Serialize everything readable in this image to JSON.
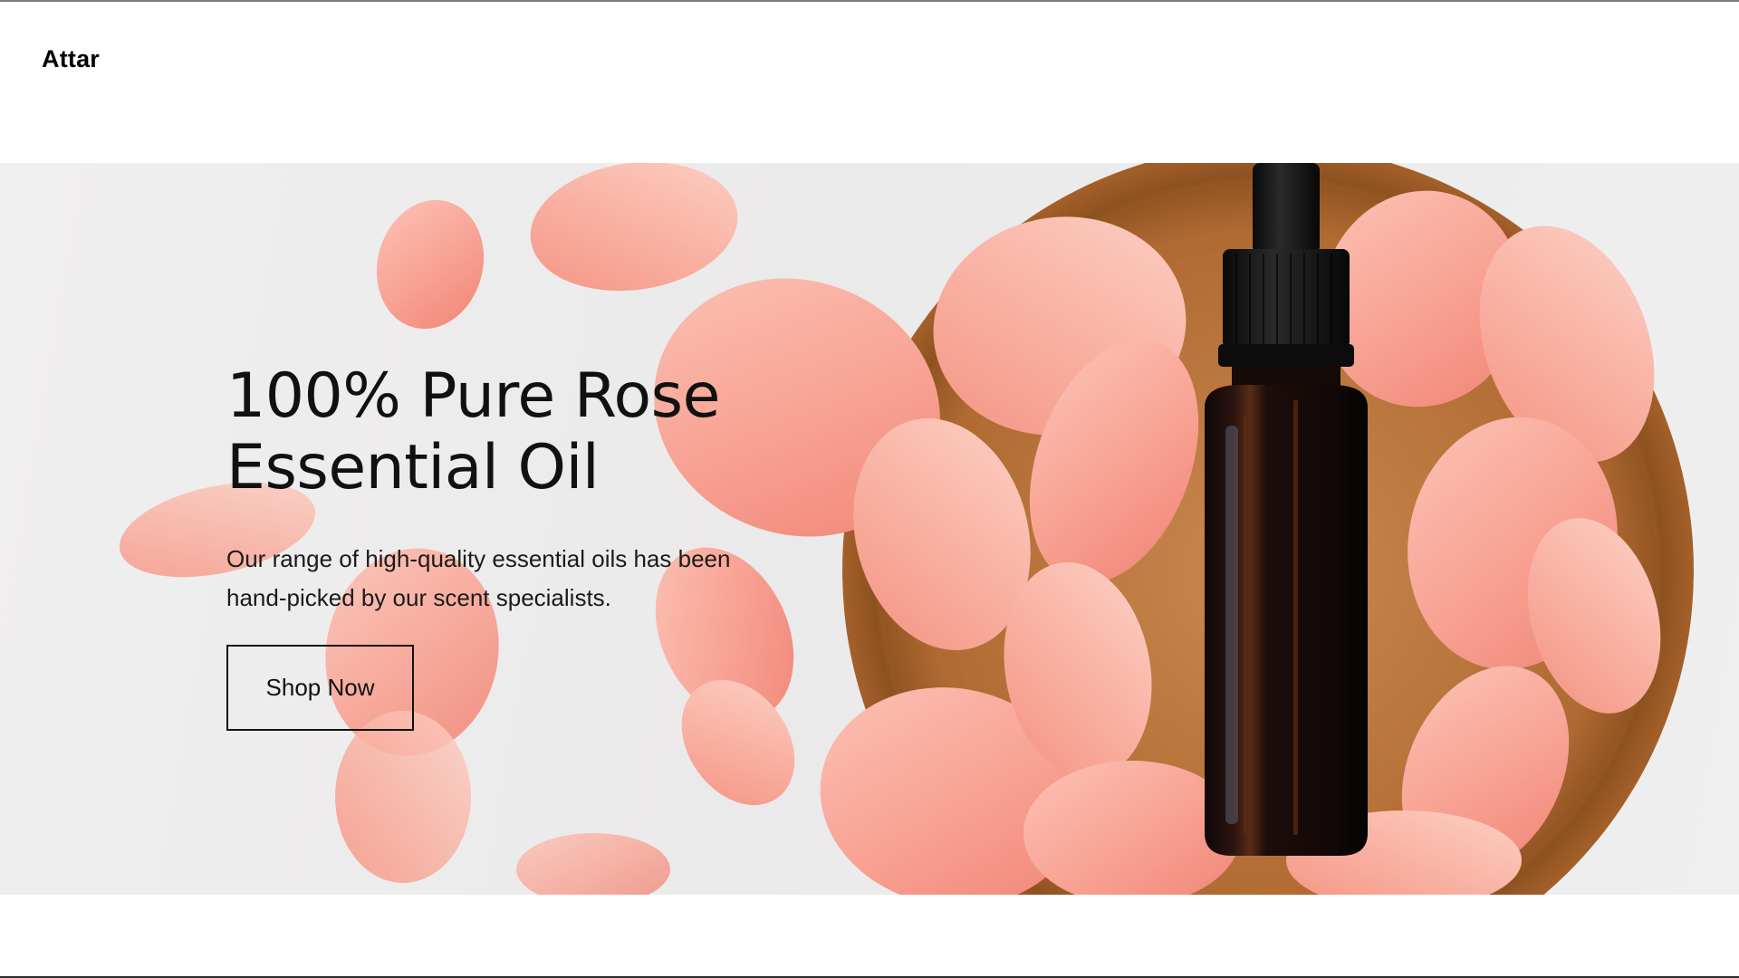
{
  "brand": {
    "name": "Attar"
  },
  "hero": {
    "title_line1": "100% Pure Rose",
    "title_line2": "Essential Oil",
    "description_line1": "Our range of high-quality essential oils has been",
    "description_line2": "hand-picked by our scent specialists.",
    "cta_label": "Shop Now",
    "image_subject": "rose-oil-bottle-on-wooden-plate-with-petals"
  },
  "colors": {
    "text": "#111111",
    "petal": "#f79a8c",
    "wood": "#b5713a",
    "bottle": "#1a0d09",
    "background": "#eeeeee"
  }
}
